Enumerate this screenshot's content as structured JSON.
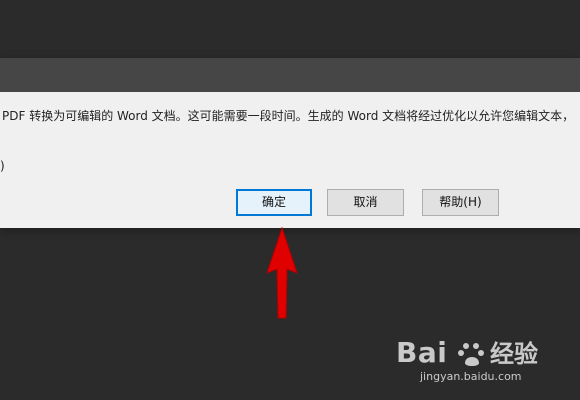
{
  "dialog": {
    "message": "PDF 转换为可编辑的 Word 文档。这可能需要一段时间。生成的 Word 文档将经过优化以允许您编辑文本，",
    "truncated_line": ")",
    "buttons": {
      "ok": "确定",
      "cancel": "取消",
      "help": "帮助(H)"
    }
  },
  "watermark": {
    "logo_text": "Bai",
    "service": "经验",
    "url": "jingyan.baidu.com"
  },
  "colors": {
    "background": "#2b2b2b",
    "dialog": "#f0f0f0",
    "titlebar": "#464646",
    "accent": "#0078d7",
    "arrow": "#e00000"
  }
}
